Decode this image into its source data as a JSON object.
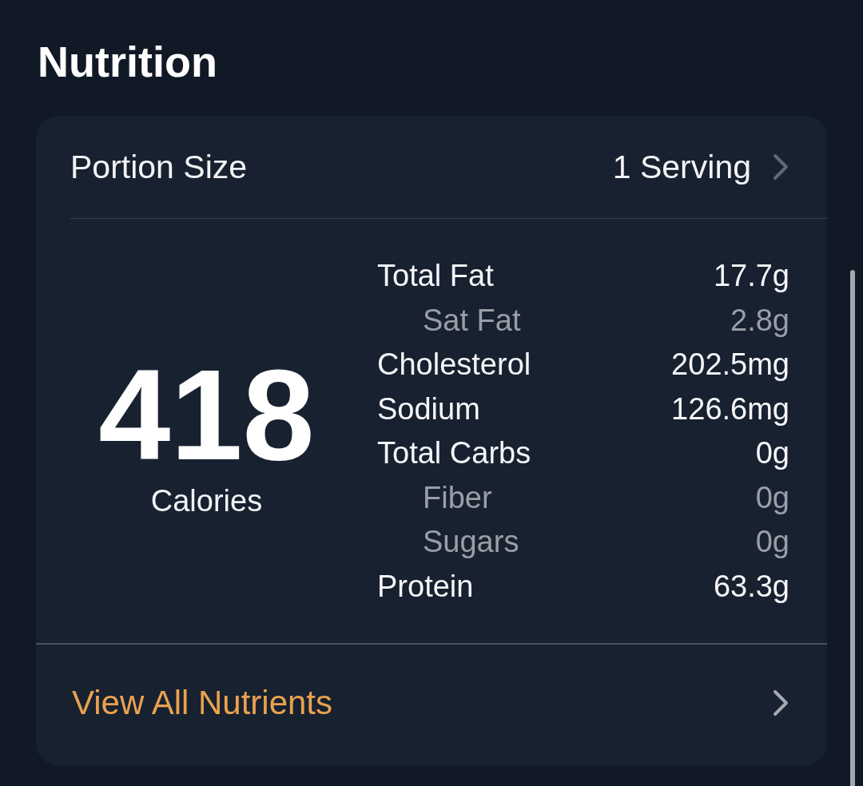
{
  "title": "Nutrition",
  "portion": {
    "label": "Portion Size",
    "value": "1 Serving"
  },
  "calories": {
    "value": "418",
    "label": "Calories"
  },
  "nutrients": [
    {
      "kind": "main",
      "name": "Total Fat",
      "amount": "17.7g"
    },
    {
      "kind": "sub",
      "name": "Sat Fat",
      "amount": "2.8g"
    },
    {
      "kind": "main",
      "name": "Cholesterol",
      "amount": "202.5mg"
    },
    {
      "kind": "main",
      "name": "Sodium",
      "amount": "126.6mg"
    },
    {
      "kind": "main",
      "name": "Total Carbs",
      "amount": "0g"
    },
    {
      "kind": "sub",
      "name": "Fiber",
      "amount": "0g"
    },
    {
      "kind": "sub",
      "name": "Sugars",
      "amount": "0g"
    },
    {
      "kind": "main",
      "name": "Protein",
      "amount": "63.3g"
    }
  ],
  "link": {
    "label": "View All Nutrients"
  }
}
